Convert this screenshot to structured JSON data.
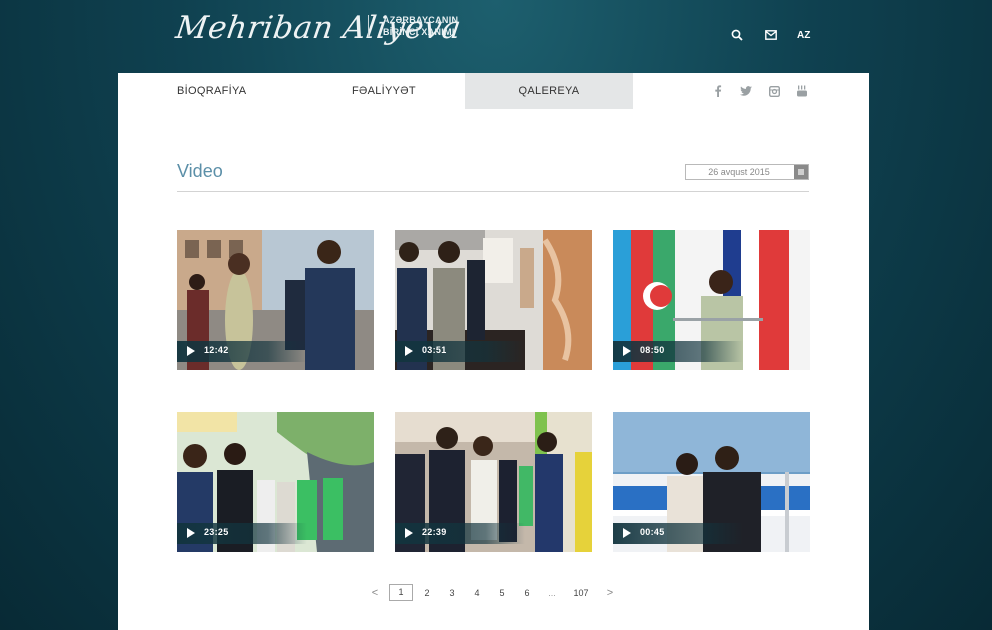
{
  "header": {
    "logo_script": "Mehriban Aliyeva",
    "tagline_line1": "AZƏRBAYCANIN",
    "tagline_line2": "BİRİNCİ XANIMI",
    "lang": "AZ",
    "icons": [
      "search-icon",
      "mail-icon"
    ]
  },
  "nav": {
    "items": [
      {
        "label": "BİOQRAFİYA",
        "active": false
      },
      {
        "label": "FƏALİYYƏT",
        "active": false
      },
      {
        "label": "QALEREYA",
        "active": true
      }
    ],
    "social": [
      "facebook-icon",
      "twitter-icon",
      "instagram-icon",
      "youtube-icon"
    ]
  },
  "section": {
    "title": "Video",
    "date": "26 avqust 2015"
  },
  "videos": [
    {
      "duration": "12:42"
    },
    {
      "duration": "03:51"
    },
    {
      "duration": "08:50"
    },
    {
      "duration": "23:25"
    },
    {
      "duration": "22:39"
    },
    {
      "duration": "00:45"
    }
  ],
  "pagination": {
    "prev": "<",
    "pages": [
      "1",
      "2",
      "3",
      "4",
      "5",
      "6"
    ],
    "ellipsis": "...",
    "last": "107",
    "next": ">",
    "current": "1"
  },
  "colors": {
    "background_dark": "#0f4150",
    "accent_title": "#5b8fa8",
    "overlay": "#12343e"
  }
}
